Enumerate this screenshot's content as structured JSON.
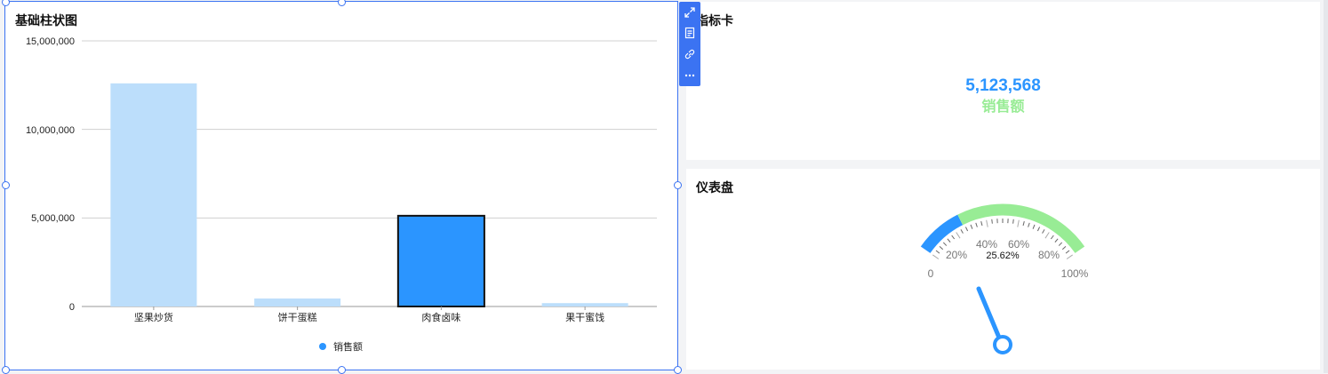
{
  "bar_chart": {
    "title": "基础柱状图",
    "legend": "销售额",
    "y_ticks": [
      "15,000,000",
      "10,000,000",
      "5,000,000",
      "0"
    ]
  },
  "chart_data": {
    "type": "bar",
    "categories": [
      "坚果炒货",
      "饼干蛋糕",
      "肉食卤味",
      "果干蜜饯"
    ],
    "series": [
      {
        "name": "销售额",
        "values": [
          12600000,
          450000,
          5123568,
          190000
        ]
      }
    ],
    "ylim": [
      0,
      15000000
    ],
    "highlighted_category": "肉食卤味",
    "grid": true,
    "legend_placement": "bottom"
  },
  "kpi_card": {
    "title": "指标卡",
    "value": "5,123,568",
    "label": "销售额"
  },
  "gauge": {
    "title": "仪表盘",
    "value_percent": 25.62,
    "value_label": "25.62%",
    "tick_labels": [
      "0",
      "20%",
      "40%",
      "60%",
      "80%",
      "100%"
    ]
  },
  "toolbar": {
    "icons": [
      "expand-icon",
      "document-icon",
      "link-icon",
      "more-icon"
    ]
  },
  "colors": {
    "accent": "#2b95ff",
    "bar_light": "#bcdefb",
    "green": "#98ec95",
    "selection": "#3b73f2"
  }
}
